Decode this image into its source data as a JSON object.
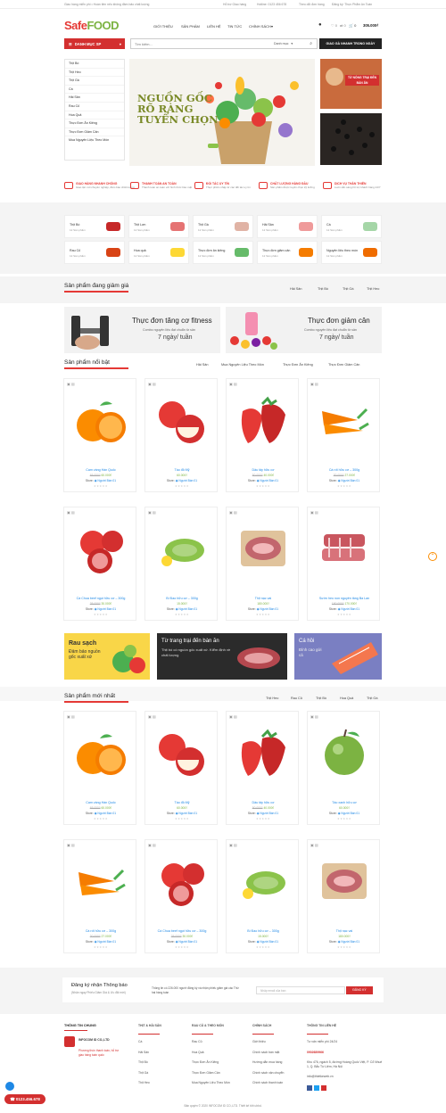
{
  "topbar": {
    "left": "Giao hàng miễn phí • Hoàn tiền nếu không đảm bảo chất lượng",
    "phone": "Hỗ trợ Giao hàng",
    "hotline": "Hotline: 0123 456 678",
    "search_label": "Theo dõi đơn hàng",
    "guide": "Đăng ký: Thực Phẩm An Toàn"
  },
  "logo": {
    "a": "Safe",
    "b": "FOOD"
  },
  "nav": [
    "GIỚI THIỆU",
    "SẢN PHẨM",
    "LIÊN HỆ",
    "TIN TỨC",
    "CHÍNH SÁCH"
  ],
  "cart": {
    "count": "0",
    "price": "305.000₫"
  },
  "menu_label": "DANH MỤC SP",
  "search": {
    "placeholder": "Tìm kiếm...",
    "category": "Danh mục",
    "button": "GIAO GÀ NHANH TRONG NGÀY"
  },
  "categories": [
    "Thịt Bò",
    "Thịt Heo",
    "Thịt Gà",
    "Cá",
    "Hải Sản",
    "Rau Củ",
    "Hoa Quả",
    "Thực Đơn Ăn Kiêng",
    "Thực Đơn Giảm Cân",
    "Mua Nguyên Liệu Theo Món"
  ],
  "banner": {
    "l1": "NGUỒN GỐC",
    "l2": "RÕ RÀNG",
    "l3": "TUYỂN CHỌN"
  },
  "side_banner": {
    "text": "TỪ NÔNG TRẠI ĐẾN BÀN ĂN"
  },
  "features": [
    {
      "t": "GIAO HÀNG NHANH CHÓNG",
      "d": "Giao tận nơi chuyên nghiệp, đảm bảo chất lượng"
    },
    {
      "t": "THANH TOÁN AN TOÀN",
      "d": "Thanh toán an toàn với hình thức bảo mật"
    },
    {
      "t": "ĐỐI TÁC UY TÍN",
      "d": "Thực phẩm nhập từ các đối tác uy tín"
    },
    {
      "t": "CHẤT LƯỢNG HÀNG ĐẦU",
      "d": "Sản phẩm được tuyển chọn kỹ lưỡng"
    },
    {
      "t": "DỊCH VỤ THÂN THIỆN",
      "d": "Luôn sẵn sàng hỗ trợ khách hàng 24/7"
    }
  ],
  "cat_cards": [
    {
      "n": "Thịt Bò",
      "c": "12 Sản phẩm"
    },
    {
      "n": "Thịt Lợn",
      "c": "12 Sản phẩm"
    },
    {
      "n": "Thịt Gà",
      "c": "12 Sản phẩm"
    },
    {
      "n": "Hải Sản",
      "c": "12 Sản phẩm"
    },
    {
      "n": "Cá",
      "c": "12 Sản phẩm"
    },
    {
      "n": "Rau Củ",
      "c": "12 Sản phẩm"
    },
    {
      "n": "Hoa quả",
      "c": "12 Sản phẩm"
    },
    {
      "n": "Thực đơn ăn kiêng",
      "c": "12 Sản phẩm"
    },
    {
      "n": "Thực đơn giảm cân",
      "c": "12 Sản phẩm"
    },
    {
      "n": "Nguyên liệu theo món",
      "c": "12 Sản phẩm"
    }
  ],
  "sale": {
    "title": "Sản phẩm đang giảm giá",
    "tabs": [
      "Hải Sản",
      "Thịt Bò",
      "Thịt Gà",
      "Thịt Heo"
    ]
  },
  "promo": [
    {
      "title": "Thực đơn tăng cơ fitness",
      "sub": "Combo nguyên liệu đạt chuẩn từ sản",
      "freq": "7 ngày/ tuần"
    },
    {
      "title": "Thực đơn giảm cân",
      "sub": "Combo nguyên liệu đạt chuẩn từ sản",
      "freq": "7 ngày/ tuần"
    }
  ],
  "featured": {
    "title": "Sản phẩm nổi bật",
    "tabs": [
      "Hải Sản",
      "Mua Nguyên Liệu Theo Món",
      "Thực Đơn Ăn Kiêng",
      "Thực Đơn Giảm Cân"
    ]
  },
  "products1": [
    {
      "n": "Cam vàng Hàn Quốc",
      "o": "65.000₫",
      "p": "60.000₫",
      "img": "orange"
    },
    {
      "n": "Táo đỏ Mỹ",
      "o": "",
      "p": "60.000₫",
      "img": "apple"
    },
    {
      "n": "Dâu tây hữu cơ",
      "o": "50.000₫",
      "p": "40.000₫",
      "img": "strawberry"
    },
    {
      "n": "Cà rốt hữu cơ – 300g",
      "o": "30.000₫",
      "p": "27.000₫",
      "img": "carrot"
    },
    {
      "n": "Cà Chua beef ngọt hữu cơ – 300g",
      "o": "35.000₫",
      "p": "30.000₫",
      "img": "tomato"
    },
    {
      "n": "Bí Đao hữu cơ – 300g",
      "o": "",
      "p": "15.000₫",
      "img": "gourd"
    },
    {
      "n": "Thịt nạc vai",
      "o": "",
      "p": "180.000₫",
      "img": "meat"
    },
    {
      "n": "Sườn heo non nguyên tảng Ba Lan",
      "o": "180.000₫",
      "p": "170.000₫",
      "img": "ribs"
    }
  ],
  "store_label": "Store:",
  "seller": "Người Bán 01",
  "mid_banners": [
    {
      "t": "Rau sạch",
      "d": "Đảm bảo nguồn gốc xuất xứ"
    },
    {
      "t": "Từ trang trại đến bàn ăn",
      "d": "Thịt bò có nguồn gốc xuất xứ. Kiểm định về chất lượng"
    },
    {
      "t": "Cá hồi",
      "d": "Đỉnh cao gửi cá"
    }
  ],
  "newest": {
    "title": "Sản phẩm mới nhất",
    "tabs": [
      "Thịt Heo",
      "Rau Củ",
      "Thịt Bò",
      "Hoa Quả",
      "Thịt Gà"
    ]
  },
  "products2": [
    {
      "n": "Cam vàng Hàn Quốc",
      "o": "65.000₫",
      "p": "60.000₫",
      "img": "orange"
    },
    {
      "n": "Táo đỏ Mỹ",
      "o": "",
      "p": "60.000₫",
      "img": "apple"
    },
    {
      "n": "Dâu tây hữu cơ",
      "o": "50.000₫",
      "p": "40.000₫",
      "img": "strawberry"
    },
    {
      "n": "Táo xanh hữu cơ",
      "o": "",
      "p": "60.000₫",
      "img": "greenapple"
    },
    {
      "n": "Cà rốt hữu cơ – 300g",
      "o": "30.000₫",
      "p": "27.000₫",
      "img": "carrot"
    },
    {
      "n": "Cà Chua beef ngọt hữu cơ – 300g",
      "o": "35.000₫",
      "p": "30.000₫",
      "img": "tomato"
    },
    {
      "n": "Bí Đao hữu cơ – 300g",
      "o": "",
      "p": "15.000₫",
      "img": "gourd"
    },
    {
      "n": "Thịt nạc vai",
      "o": "",
      "p": "180.000₫",
      "img": "meat"
    }
  ],
  "newsletter": {
    "title": "Đăng ký nhận Thông báo",
    "sub": "(Nhận ngay Phiếu Giảm Giá & Ưu đãi mới)",
    "desc": "Thông tin có 226.000 người đăng ký và nhận phiếu giảm giá các Thứ hai hàng tuần",
    "placeholder": "Nhập email của bạn",
    "button": "ĐĂNG KÝ"
  },
  "footer": {
    "cols": [
      {
        "h": "THÔNG TIN CHUNG",
        "items": [
          "INFOCOM ID CO.,LTD",
          "Phương thức thanh toán, hỗ trợ giao hàng toàn quốc"
        ]
      },
      {
        "h": "THỊT & HẢI SẢN",
        "items": [
          "Cá",
          "Hải Sản",
          "Thịt Bò",
          "Thịt Gà",
          "Thịt Heo"
        ]
      },
      {
        "h": "RAU CỦ & THEO MÓN",
        "items": [
          "Rau Củ",
          "Hoa Quả",
          "Thực Đơn Ăn Kiêng",
          "Thực Đơn Giảm Cân",
          "Mua Nguyên Liệu Theo Món"
        ]
      },
      {
        "h": "CHÍNH SÁCH",
        "items": [
          "Giới thiệu",
          "Chính sách bán mặt",
          "Hướng dẫn mua hàng",
          "Chính sách vận chuyển",
          "Chính sách thanh toán"
        ]
      },
      {
        "h": "THÔNG TIN LIÊN HỆ",
        "items": [
          "Tư vấn miễn phí 24/24",
          "0902689966",
          "Khu 476, ngách 5, đường Hoàng Quốc Việt, P. Cổ Nhuế 1, Q. Bắc Từ Liêm, Hà Nội",
          "info@thietkeweb.vn"
        ]
      }
    ],
    "copyright": "Bản quyền © 2020 INFOCOM ID CO.,LTD. Thiết kế bởi ubbd."
  },
  "float_phone": "0123.456.678"
}
